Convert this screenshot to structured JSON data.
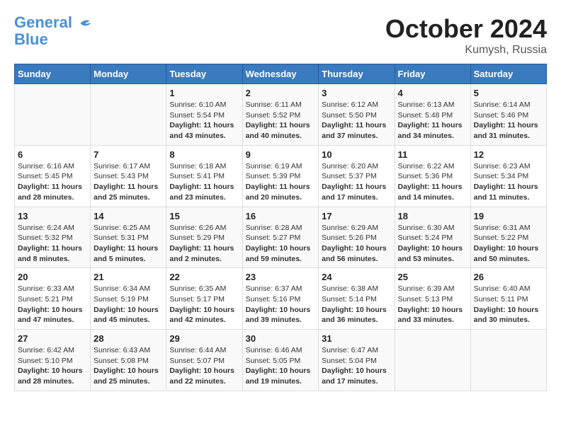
{
  "header": {
    "logo_line1": "General",
    "logo_line2": "Blue",
    "month": "October 2024",
    "location": "Kumysh, Russia"
  },
  "days_of_week": [
    "Sunday",
    "Monday",
    "Tuesday",
    "Wednesday",
    "Thursday",
    "Friday",
    "Saturday"
  ],
  "weeks": [
    [
      {
        "day": "",
        "content": ""
      },
      {
        "day": "",
        "content": ""
      },
      {
        "day": "1",
        "content": "Sunrise: 6:10 AM\nSunset: 5:54 PM\nDaylight: 11 hours and 43 minutes."
      },
      {
        "day": "2",
        "content": "Sunrise: 6:11 AM\nSunset: 5:52 PM\nDaylight: 11 hours and 40 minutes."
      },
      {
        "day": "3",
        "content": "Sunrise: 6:12 AM\nSunset: 5:50 PM\nDaylight: 11 hours and 37 minutes."
      },
      {
        "day": "4",
        "content": "Sunrise: 6:13 AM\nSunset: 5:48 PM\nDaylight: 11 hours and 34 minutes."
      },
      {
        "day": "5",
        "content": "Sunrise: 6:14 AM\nSunset: 5:46 PM\nDaylight: 11 hours and 31 minutes."
      }
    ],
    [
      {
        "day": "6",
        "content": "Sunrise: 6:16 AM\nSunset: 5:45 PM\nDaylight: 11 hours and 28 minutes."
      },
      {
        "day": "7",
        "content": "Sunrise: 6:17 AM\nSunset: 5:43 PM\nDaylight: 11 hours and 25 minutes."
      },
      {
        "day": "8",
        "content": "Sunrise: 6:18 AM\nSunset: 5:41 PM\nDaylight: 11 hours and 23 minutes."
      },
      {
        "day": "9",
        "content": "Sunrise: 6:19 AM\nSunset: 5:39 PM\nDaylight: 11 hours and 20 minutes."
      },
      {
        "day": "10",
        "content": "Sunrise: 6:20 AM\nSunset: 5:37 PM\nDaylight: 11 hours and 17 minutes."
      },
      {
        "day": "11",
        "content": "Sunrise: 6:22 AM\nSunset: 5:36 PM\nDaylight: 11 hours and 14 minutes."
      },
      {
        "day": "12",
        "content": "Sunrise: 6:23 AM\nSunset: 5:34 PM\nDaylight: 11 hours and 11 minutes."
      }
    ],
    [
      {
        "day": "13",
        "content": "Sunrise: 6:24 AM\nSunset: 5:32 PM\nDaylight: 11 hours and 8 minutes."
      },
      {
        "day": "14",
        "content": "Sunrise: 6:25 AM\nSunset: 5:31 PM\nDaylight: 11 hours and 5 minutes."
      },
      {
        "day": "15",
        "content": "Sunrise: 6:26 AM\nSunset: 5:29 PM\nDaylight: 11 hours and 2 minutes."
      },
      {
        "day": "16",
        "content": "Sunrise: 6:28 AM\nSunset: 5:27 PM\nDaylight: 10 hours and 59 minutes."
      },
      {
        "day": "17",
        "content": "Sunrise: 6:29 AM\nSunset: 5:26 PM\nDaylight: 10 hours and 56 minutes."
      },
      {
        "day": "18",
        "content": "Sunrise: 6:30 AM\nSunset: 5:24 PM\nDaylight: 10 hours and 53 minutes."
      },
      {
        "day": "19",
        "content": "Sunrise: 6:31 AM\nSunset: 5:22 PM\nDaylight: 10 hours and 50 minutes."
      }
    ],
    [
      {
        "day": "20",
        "content": "Sunrise: 6:33 AM\nSunset: 5:21 PM\nDaylight: 10 hours and 47 minutes."
      },
      {
        "day": "21",
        "content": "Sunrise: 6:34 AM\nSunset: 5:19 PM\nDaylight: 10 hours and 45 minutes."
      },
      {
        "day": "22",
        "content": "Sunrise: 6:35 AM\nSunset: 5:17 PM\nDaylight: 10 hours and 42 minutes."
      },
      {
        "day": "23",
        "content": "Sunrise: 6:37 AM\nSunset: 5:16 PM\nDaylight: 10 hours and 39 minutes."
      },
      {
        "day": "24",
        "content": "Sunrise: 6:38 AM\nSunset: 5:14 PM\nDaylight: 10 hours and 36 minutes."
      },
      {
        "day": "25",
        "content": "Sunrise: 6:39 AM\nSunset: 5:13 PM\nDaylight: 10 hours and 33 minutes."
      },
      {
        "day": "26",
        "content": "Sunrise: 6:40 AM\nSunset: 5:11 PM\nDaylight: 10 hours and 30 minutes."
      }
    ],
    [
      {
        "day": "27",
        "content": "Sunrise: 6:42 AM\nSunset: 5:10 PM\nDaylight: 10 hours and 28 minutes."
      },
      {
        "day": "28",
        "content": "Sunrise: 6:43 AM\nSunset: 5:08 PM\nDaylight: 10 hours and 25 minutes."
      },
      {
        "day": "29",
        "content": "Sunrise: 6:44 AM\nSunset: 5:07 PM\nDaylight: 10 hours and 22 minutes."
      },
      {
        "day": "30",
        "content": "Sunrise: 6:46 AM\nSunset: 5:05 PM\nDaylight: 10 hours and 19 minutes."
      },
      {
        "day": "31",
        "content": "Sunrise: 6:47 AM\nSunset: 5:04 PM\nDaylight: 10 hours and 17 minutes."
      },
      {
        "day": "",
        "content": ""
      },
      {
        "day": "",
        "content": ""
      }
    ]
  ]
}
